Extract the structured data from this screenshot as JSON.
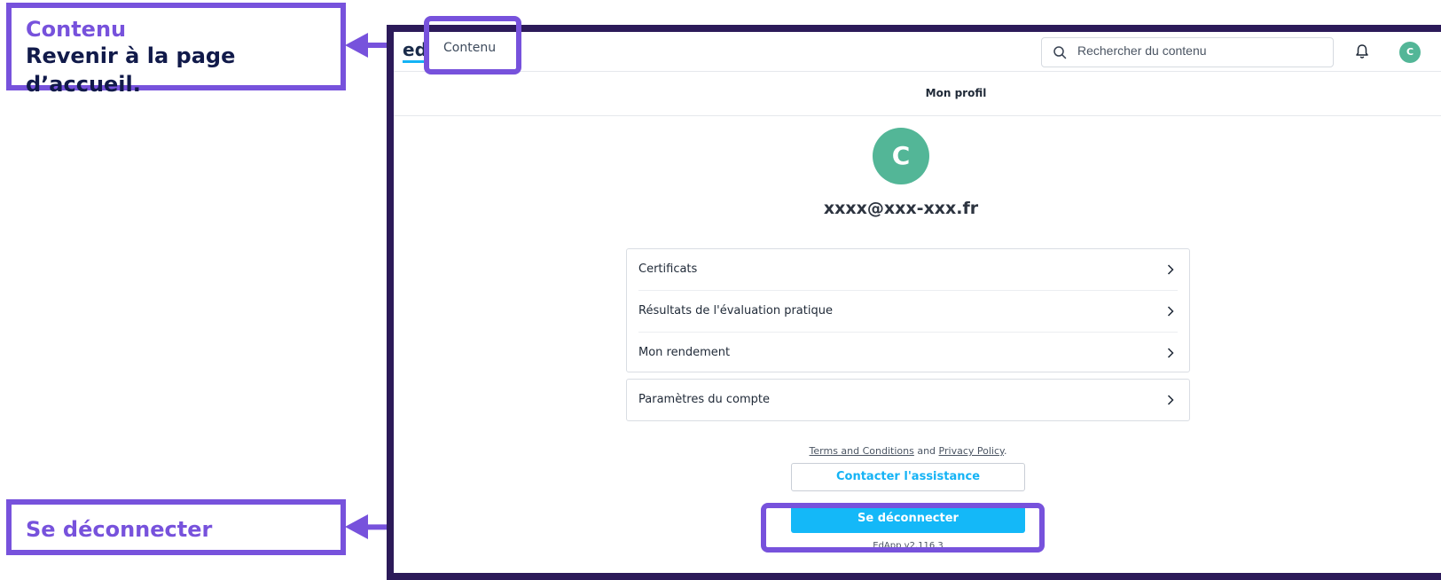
{
  "callouts": {
    "home": {
      "title": "Contenu",
      "description": "Revenir à la page d’accueil."
    },
    "logout": {
      "title": "Se déconnecter"
    }
  },
  "colors": {
    "accent": "#7752dc",
    "frame": "#2c1a59",
    "brand": "#14b8f8",
    "avatar": "#53b697"
  },
  "header": {
    "logo": "ed",
    "nav_contenu": "Contenu",
    "search_placeholder": "Rechercher du contenu",
    "icons": [
      "search-icon",
      "bell-icon"
    ],
    "avatar_initial": "C"
  },
  "page": {
    "title": "Mon profil",
    "avatar_initial": "C",
    "email": "xxxx@xxx-xxx.fr"
  },
  "menu": {
    "items": [
      {
        "label": "Certificats"
      },
      {
        "label": "Résultats de l'évaluation pratique"
      },
      {
        "label": "Mon rendement"
      }
    ],
    "account": {
      "label": "Paramètres du compte"
    }
  },
  "footer": {
    "terms": "Terms and Conditions",
    "and": "and",
    "privacy": "Privacy Policy",
    "period": ".",
    "contact_button": "Contacter l'assistance",
    "logout_button": "Se déconnecter",
    "version": "EdApp v2.116.3"
  }
}
